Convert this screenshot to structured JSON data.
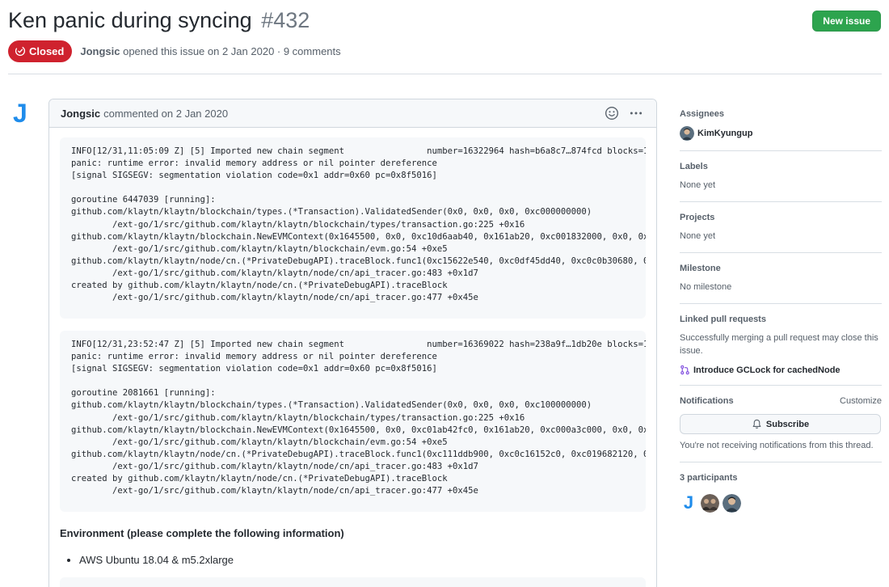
{
  "issue": {
    "title": "Ken panic during syncing",
    "number": "#432",
    "status": "Closed",
    "author": "Jongsic",
    "opened_text": "opened this issue on 2 Jan 2020 · 9 comments"
  },
  "header_actions": {
    "new_issue_label": "New issue"
  },
  "comment": {
    "author": "Jongsic",
    "date_text": "commented on 2 Jan 2020",
    "avatar_letter": "J",
    "code_block_1": "INFO[12/31,11:05:09 Z] [5] Imported new chain segment                number=16322964 hash=b6a8c7…874fcd blocks=1\npanic: runtime error: invalid memory address or nil pointer dereference\n[signal SIGSEGV: segmentation violation code=0x1 addr=0x60 pc=0x8f5016]\n\ngoroutine 6447039 [running]:\ngithub.com/klaytn/klaytn/blockchain/types.(*Transaction).ValidatedSender(0x0, 0x0, 0x0, 0xc000000000)\n        /ext-go/1/src/github.com/klaytn/klaytn/blockchain/types/transaction.go:225 +0x16\ngithub.com/klaytn/klaytn/blockchain.NewEVMContext(0x1645500, 0x0, 0xc10d6aab40, 0x161ab20, 0xc001832000, 0x0, 0x\n        /ext-go/1/src/github.com/klaytn/klaytn/blockchain/evm.go:54 +0xe5\ngithub.com/klaytn/klaytn/node/cn.(*PrivateDebugAPI).traceBlock.func1(0xc15622e540, 0xc0df45dd40, 0xc0c0b30680, 0\n        /ext-go/1/src/github.com/klaytn/klaytn/node/cn/api_tracer.go:483 +0x1d7\ncreated by github.com/klaytn/klaytn/node/cn.(*PrivateDebugAPI).traceBlock\n        /ext-go/1/src/github.com/klaytn/klaytn/node/cn/api_tracer.go:477 +0x45e",
    "code_block_2": "INFO[12/31,23:52:47 Z] [5] Imported new chain segment                number=16369022 hash=238a9f…1db20e blocks=1\npanic: runtime error: invalid memory address or nil pointer dereference\n[signal SIGSEGV: segmentation violation code=0x1 addr=0x60 pc=0x8f5016]\n\ngoroutine 2081661 [running]:\ngithub.com/klaytn/klaytn/blockchain/types.(*Transaction).ValidatedSender(0x0, 0x0, 0x0, 0xc100000000)\n        /ext-go/1/src/github.com/klaytn/klaytn/blockchain/types/transaction.go:225 +0x16\ngithub.com/klaytn/klaytn/blockchain.NewEVMContext(0x1645500, 0x0, 0xc01ab42fc0, 0x161ab20, 0xc000a3c000, 0x0, 0x\n        /ext-go/1/src/github.com/klaytn/klaytn/blockchain/evm.go:54 +0xe5\ngithub.com/klaytn/klaytn/node/cn.(*PrivateDebugAPI).traceBlock.func1(0xc111ddb900, 0xc0c16152c0, 0xc019682120, 0\n        /ext-go/1/src/github.com/klaytn/klaytn/node/cn/api_tracer.go:483 +0x1d7\ncreated by github.com/klaytn/klaytn/node/cn.(*PrivateDebugAPI).traceBlock\n        /ext-go/1/src/github.com/klaytn/klaytn/node/cn/api_tracer.go:477 +0x45e",
    "env_heading": "Environment (please complete the following information)",
    "env_items": [
      "AWS Ubuntu 18.04 & m5.2xlarge"
    ]
  },
  "sidebar": {
    "assignees": {
      "title": "Assignees",
      "user": "KimKyungup"
    },
    "labels": {
      "title": "Labels",
      "value": "None yet"
    },
    "projects": {
      "title": "Projects",
      "value": "None yet"
    },
    "milestone": {
      "title": "Milestone",
      "value": "No milestone"
    },
    "linked_prs": {
      "title": "Linked pull requests",
      "description": "Successfully merging a pull request may close this issue.",
      "pr_title": "Introduce GCLock for cachedNode"
    },
    "notifications": {
      "title": "Notifications",
      "customize": "Customize",
      "subscribe_label": "Subscribe",
      "status_text": "You're not receiving notifications from this thread."
    },
    "participants": {
      "title": "3 participants",
      "first_letter": "J"
    }
  },
  "colors": {
    "closed_red": "#cf222e",
    "new_issue_green": "#2da44e",
    "avatar_blue": "#1f8ceb"
  },
  "icons": [
    "issue-closed-icon",
    "smiley-icon",
    "kebab-horizontal-icon",
    "git-pull-request-icon",
    "bell-icon"
  ]
}
